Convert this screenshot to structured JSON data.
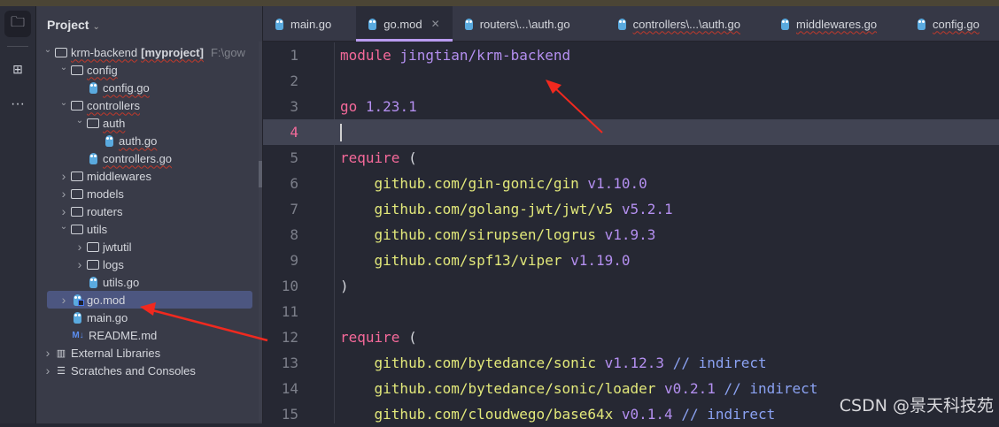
{
  "project_panel": {
    "title": "Project",
    "tree": [
      {
        "label": "krm-backend",
        "bold": "[myproject]",
        "path": "F:\\gow",
        "level": 0,
        "type": "folder",
        "open": true
      },
      {
        "label": "config",
        "level": 1,
        "type": "folder",
        "open": true
      },
      {
        "label": "config.go",
        "level": 2,
        "type": "go"
      },
      {
        "label": "controllers",
        "level": 1,
        "type": "folder",
        "open": true
      },
      {
        "label": "auth",
        "level": 2,
        "type": "folder",
        "open": true
      },
      {
        "label": "auth.go",
        "level": 3,
        "type": "go"
      },
      {
        "label": "controllers.go",
        "level": 2,
        "type": "go"
      },
      {
        "label": "middlewares",
        "level": 1,
        "type": "folder",
        "open": false
      },
      {
        "label": "models",
        "level": 1,
        "type": "folder",
        "open": false
      },
      {
        "label": "routers",
        "level": 1,
        "type": "folder",
        "open": false
      },
      {
        "label": "utils",
        "level": 1,
        "type": "folder",
        "open": true
      },
      {
        "label": "jwtutil",
        "level": 2,
        "type": "folder",
        "open": false
      },
      {
        "label": "logs",
        "level": 2,
        "type": "folder",
        "open": false
      },
      {
        "label": "utils.go",
        "level": 2,
        "type": "go"
      },
      {
        "label": "go.mod",
        "level": 1,
        "type": "mod",
        "selected": true
      },
      {
        "label": "main.go",
        "level": 1,
        "type": "go"
      },
      {
        "label": "README.md",
        "level": 1,
        "type": "md"
      },
      {
        "label": "External Libraries",
        "level": 0,
        "type": "lib"
      },
      {
        "label": "Scratches and Consoles",
        "level": 0,
        "type": "scratch"
      }
    ]
  },
  "tabs": [
    {
      "label": "main.go"
    },
    {
      "label": "go.mod",
      "active": true
    },
    {
      "label": "routers\\...\\auth.go"
    },
    {
      "label": "controllers\\...\\auth.go"
    },
    {
      "label": "middlewares.go"
    },
    {
      "label": "config.go"
    }
  ],
  "code": [
    {
      "n": "1",
      "parts": [
        [
          "kw",
          "module "
        ],
        [
          "mod",
          "jingtian/krm-backend"
        ]
      ]
    },
    {
      "n": "2",
      "parts": []
    },
    {
      "n": "3",
      "parts": [
        [
          "kw",
          "go "
        ],
        [
          "ver",
          "1.23.1"
        ]
      ]
    },
    {
      "n": "4",
      "parts": [],
      "current": true
    },
    {
      "n": "5",
      "parts": [
        [
          "kw",
          "require "
        ],
        [
          "pl",
          "("
        ]
      ]
    },
    {
      "n": "6",
      "parts": [
        [
          "pl",
          "    "
        ],
        [
          "pkg",
          "github.com/gin-gonic/gin "
        ],
        [
          "ver",
          "v1.10.0"
        ]
      ]
    },
    {
      "n": "7",
      "parts": [
        [
          "pl",
          "    "
        ],
        [
          "pkg",
          "github.com/golang-jwt/jwt/v5 "
        ],
        [
          "ver",
          "v5.2.1"
        ]
      ]
    },
    {
      "n": "8",
      "parts": [
        [
          "pl",
          "    "
        ],
        [
          "pkg",
          "github.com/sirupsen/logrus "
        ],
        [
          "ver",
          "v1.9.3"
        ]
      ]
    },
    {
      "n": "9",
      "parts": [
        [
          "pl",
          "    "
        ],
        [
          "pkg",
          "github.com/spf13/viper "
        ],
        [
          "ver",
          "v1.19.0"
        ]
      ]
    },
    {
      "n": "10",
      "parts": [
        [
          "pl",
          ")"
        ]
      ]
    },
    {
      "n": "11",
      "parts": []
    },
    {
      "n": "12",
      "parts": [
        [
          "kw",
          "require "
        ],
        [
          "pl",
          "("
        ]
      ]
    },
    {
      "n": "13",
      "parts": [
        [
          "pl",
          "    "
        ],
        [
          "pkg",
          "github.com/bytedance/sonic "
        ],
        [
          "ver",
          "v1.12.3 "
        ],
        [
          "cm",
          "// indirect"
        ]
      ]
    },
    {
      "n": "14",
      "parts": [
        [
          "pl",
          "    "
        ],
        [
          "pkg",
          "github.com/bytedance/sonic/loader "
        ],
        [
          "ver",
          "v0.2.1 "
        ],
        [
          "cm",
          "// indirect"
        ]
      ]
    },
    {
      "n": "15",
      "parts": [
        [
          "pl",
          "    "
        ],
        [
          "pkg",
          "github.com/cloudwego/base64x "
        ],
        [
          "ver",
          "v0.1.4 "
        ],
        [
          "cm",
          "// indirect"
        ]
      ]
    }
  ],
  "watermark": "CSDN @景天科技苑"
}
